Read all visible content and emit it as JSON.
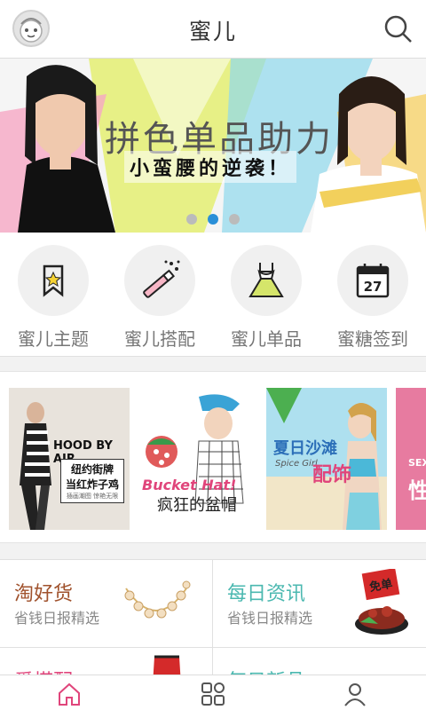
{
  "header": {
    "title": "蜜儿",
    "avatar_icon": "avatar-icon",
    "search_icon": "search-icon"
  },
  "banner": {
    "headline": "拼色单品助力",
    "subline": "小蛮腰的逆袭！",
    "active_index": 1,
    "dot_count": 3,
    "accent": "#2a8fd8"
  },
  "categories": [
    {
      "label": "蜜儿主题",
      "icon": "bookmark-star-icon"
    },
    {
      "label": "蜜儿搭配",
      "icon": "magic-wand-icon"
    },
    {
      "label": "蜜儿单品",
      "icon": "dress-icon"
    },
    {
      "label": "蜜糖签到",
      "icon": "calendar-icon",
      "day": "27"
    }
  ],
  "cards": [
    {
      "lines": [
        "HOOD BY AIR",
        "纽约街牌",
        "当红炸子鸡",
        "插画潮图   惊艳无限"
      ]
    },
    {
      "lines": [
        "Bucket Hat!",
        "疯狂的盆帽"
      ]
    },
    {
      "lines": [
        "夏日沙滩",
        "配饰",
        "Spice Girl"
      ]
    },
    {
      "lines": [
        "SEX",
        "性"
      ]
    }
  ],
  "grid": [
    {
      "title": "淘好货",
      "subtitle": "省钱日报精选",
      "color": "#a0522d"
    },
    {
      "title": "每日资讯",
      "subtitle": "省钱日报精选",
      "color": "#4bb8b0"
    },
    {
      "title": "爱搭配",
      "subtitle": "",
      "color": "#e0457b"
    },
    {
      "title": "每日新品",
      "subtitle": "",
      "color": "#4bb8b0"
    }
  ],
  "grid_badge": "免单",
  "tabbar": [
    {
      "icon": "home-icon",
      "color": "#e0457b"
    },
    {
      "icon": "grid-icon",
      "color": "#666"
    },
    {
      "icon": "profile-icon",
      "color": "#666"
    }
  ]
}
